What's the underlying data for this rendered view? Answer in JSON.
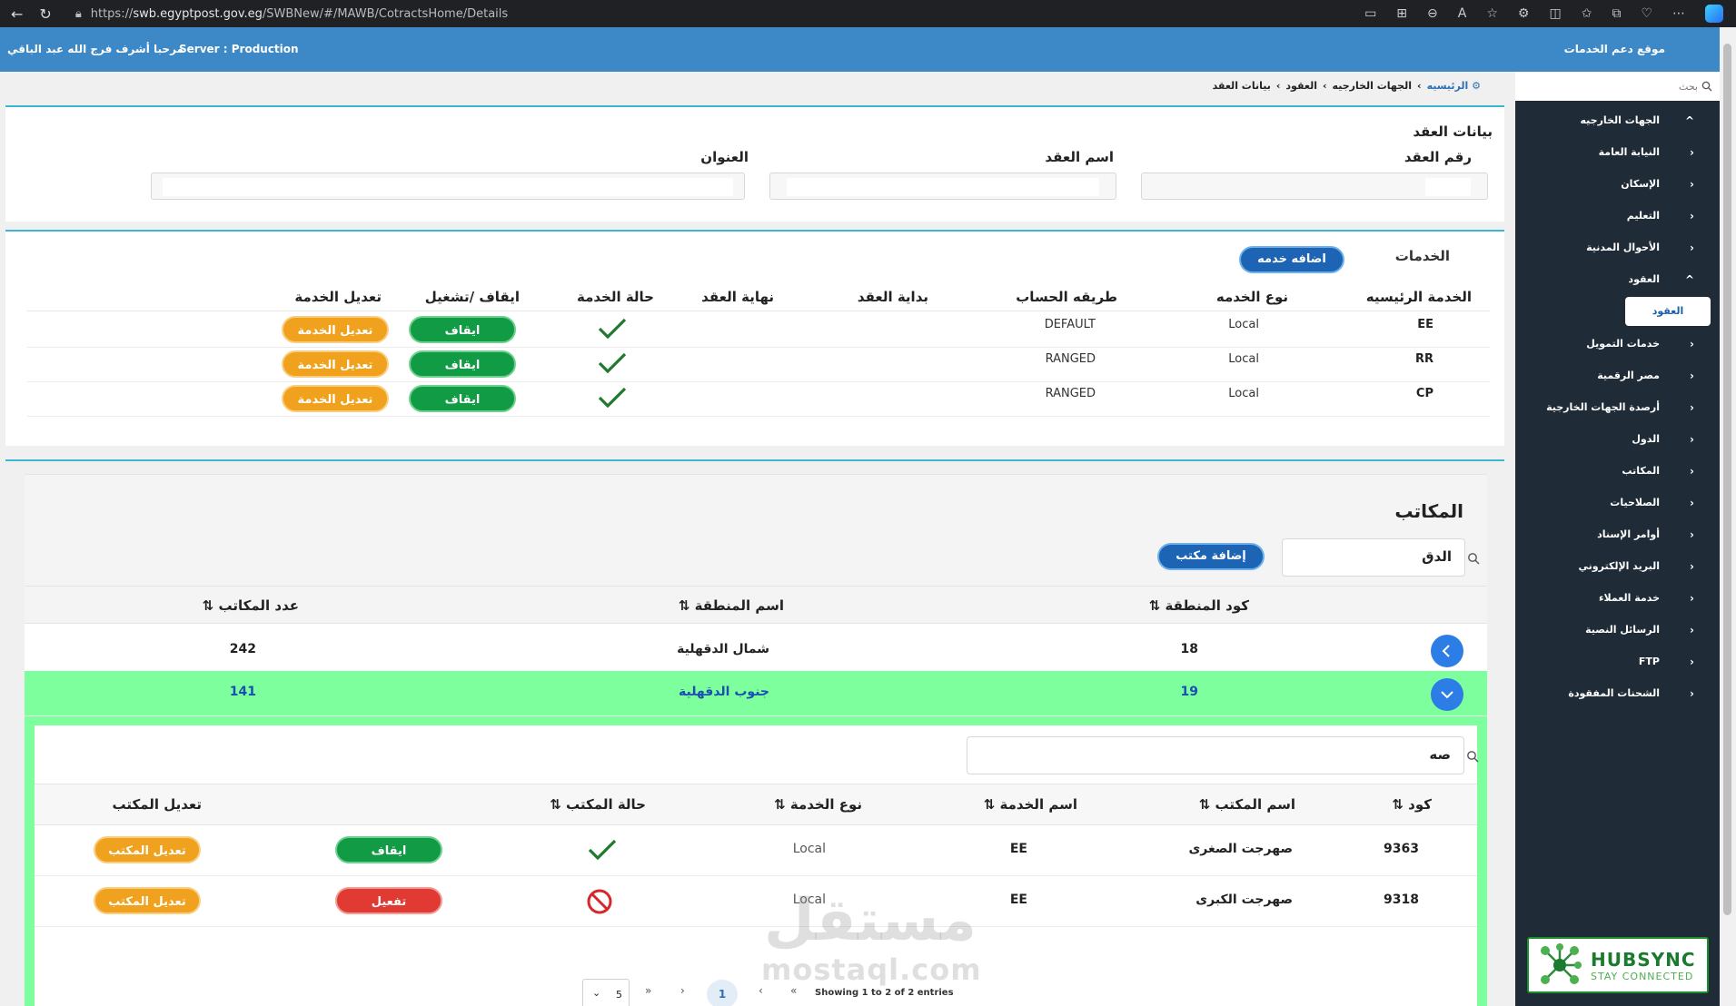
{
  "browser": {
    "url_prefix": "https://",
    "url_host": "swb.egyptpost.gov.eg",
    "url_path": "/SWBNew/#/MAWB/CotractsHome/Details"
  },
  "header": {
    "welcome": "مرحبا أشرف فرج الله عبد الباقي",
    "server": "Server : Production"
  },
  "sidebar": {
    "brand": "موقع دعم الخدمات",
    "search_placeholder": "بحث",
    "items": [
      {
        "label": "الجهات الخارجيه",
        "chev": "^"
      },
      {
        "label": "النيابة العامة",
        "chev": "‹"
      },
      {
        "label": "الإسكان",
        "chev": "‹"
      },
      {
        "label": "التعليم",
        "chev": "‹"
      },
      {
        "label": "الأحوال المدنية",
        "chev": "‹"
      },
      {
        "label": "العقود",
        "chev": "^"
      },
      {
        "label": "العقود",
        "sub": true
      },
      {
        "label": "خدمات التمويل",
        "chev": "‹"
      },
      {
        "label": "مصر الرقمية",
        "chev": "‹"
      },
      {
        "label": "أرصدة الجهات الخارجية",
        "chev": "‹"
      },
      {
        "label": "الدول",
        "chev": "‹"
      },
      {
        "label": "المكاتب",
        "chev": "‹"
      },
      {
        "label": "الصلاحيات",
        "chev": "‹"
      },
      {
        "label": "أوامر الإسناد",
        "chev": "‹"
      },
      {
        "label": "البريد الإلكتروني",
        "chev": "‹"
      },
      {
        "label": "خدمة العملاء",
        "chev": "‹"
      },
      {
        "label": "الرسائل النصية",
        "chev": "‹"
      },
      {
        "label": "FTP",
        "chev": "‹"
      },
      {
        "label": "الشحنات المفقودة",
        "chev": "‹"
      }
    ],
    "logo_line1": "HUBSYNC",
    "logo_line2": "STAY CONNECTED"
  },
  "breadcrumb": [
    "الرئيسيه",
    "الجهات الخارجيه",
    "العقود",
    "بيانات العقد"
  ],
  "contract": {
    "title": "بيانات العقد",
    "number_label": "رقم العقد",
    "name_label": "اسم العقد",
    "address_label": "العنوان"
  },
  "services": {
    "title": "الخدمات",
    "add_button": "اضافه خدمه",
    "columns": [
      "الخدمة الرئيسيه",
      "نوع الخدمه",
      "طريقه الحساب",
      "بداية العقد",
      "نهاية العقد",
      "حالة الخدمة",
      "ايقاف /تشغيل",
      "تعديل الخدمة"
    ],
    "rows": [
      {
        "main": "EE",
        "type": "Local",
        "calc": "DEFAULT",
        "start": "",
        "end": "",
        "toggle": "ايقاف",
        "edit": "تعديل الخدمة"
      },
      {
        "main": "RR",
        "type": "Local",
        "calc": "RANGED",
        "start": "",
        "end": "",
        "toggle": "ايقاف",
        "edit": "تعديل الخدمة"
      },
      {
        "main": "CP",
        "type": "Local",
        "calc": "RANGED",
        "start": "",
        "end": "",
        "toggle": "ايقاف",
        "edit": "تعديل الخدمة"
      }
    ]
  },
  "offices": {
    "title": "المكاتب",
    "search_value": "الدق",
    "add_button": "إضافة مكتب",
    "columns": [
      "كود المنطقة ⇅",
      "اسم المنطقة ⇅",
      "عدد المكاتب ⇅"
    ],
    "regions": [
      {
        "code": "18",
        "name": "شمال الدقهلية",
        "count": "242"
      },
      {
        "code": "19",
        "name": "جنوب الدقهلية",
        "count": "141"
      }
    ],
    "nested": {
      "search_value": "صه",
      "columns": [
        "كود ⇅",
        "اسم المكتب ⇅",
        "اسم الخدمة ⇅",
        "نوع الخدمة ⇅",
        "حالة المكتب ⇅",
        "تعديل المكتب"
      ],
      "rows": [
        {
          "code": "9363",
          "name": "صهرجت الصغرى",
          "service": "EE",
          "type": "Local",
          "status": "active",
          "toggle": "ايقاف",
          "edit": "تعديل المكتب"
        },
        {
          "code": "9318",
          "name": "صهرجت الكبرى",
          "service": "EE",
          "type": "Local",
          "status": "inactive",
          "toggle": "تفعيل",
          "edit": "تعديل المكتب"
        }
      ],
      "pager": {
        "info": "Showing 1 to 2 of 2 entries",
        "first": "«",
        "prev": "‹",
        "current": "1",
        "next": "›",
        "last": "»",
        "page_size": "5"
      }
    }
  },
  "watermark": {
    "line1": "مستقل",
    "line2": "mostaql.com"
  }
}
